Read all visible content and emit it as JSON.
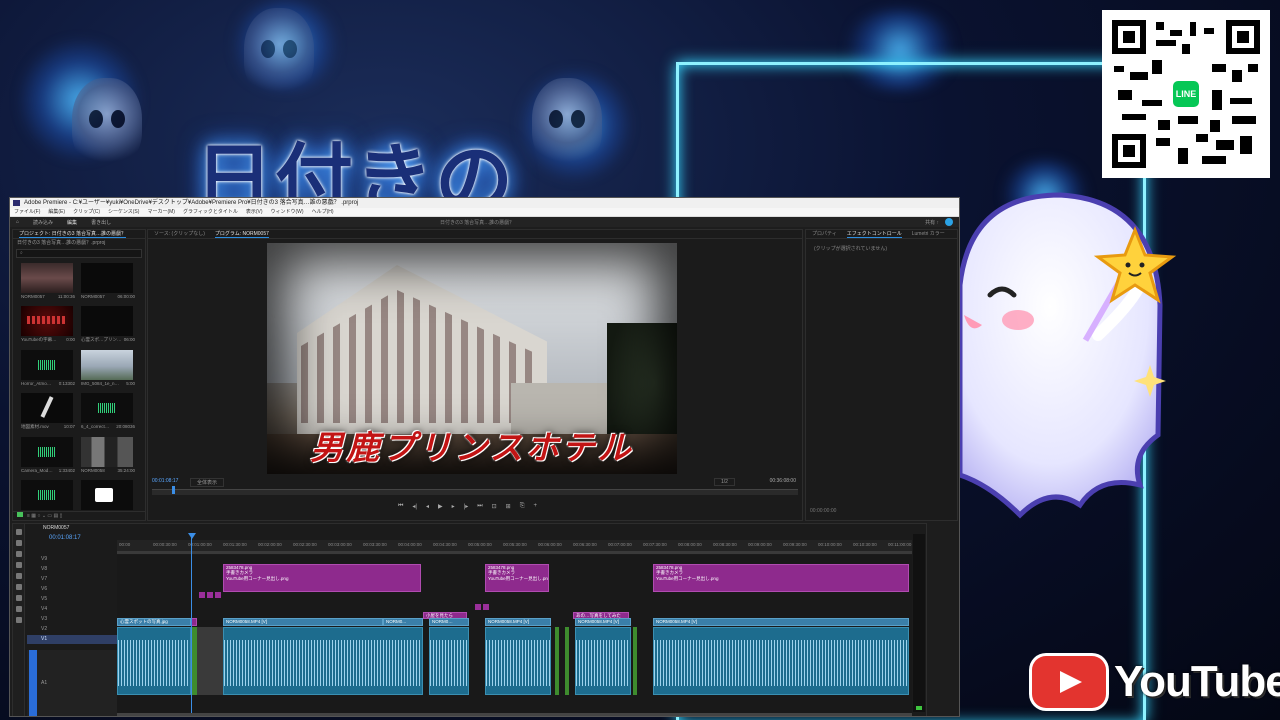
{
  "overlay": {
    "title_text": "日付きの",
    "line_label": "LINE",
    "youtube_label": "YouTube"
  },
  "premiere": {
    "titlebar": "Adobe Premiere - C:¥ユーザー¥yuki¥OneDrive¥デスクトップ¥Adobe¥Premiere Pro¥日付きの3 落合写真…誰の悪戯？ .prproj",
    "menu": [
      "ファイル(F)",
      "編集(E)",
      "クリップ(C)",
      "シーケンス(S)",
      "マーカー(M)",
      "グラフィックとタイトル",
      "表示(V)",
      "ウィンドウ(W)",
      "ヘルプ(H)"
    ],
    "workspaces": [
      "ホーム",
      "読み込み",
      "編集",
      "書き出し"
    ],
    "doc_title": "日付きの3 落合写真…誰の悪戯？",
    "share_label": "共有 ↑",
    "project": {
      "tab": "プロジェクト: 日付きの3 落合写真…誰の悪戯？",
      "path": "日付きの3 落合写真…誰の悪戯？.prproj",
      "items": [
        {
          "name": "NORM0057",
          "dur": "11:00:36"
        },
        {
          "name": "NORM0057",
          "dur": "06:00:00"
        },
        {
          "name": "YouTubeの字幕…",
          "dur": "0:00"
        },
        {
          "name": "心霊スポ…プリン…",
          "dur": "06:00"
        },
        {
          "name": "Horror_Atmo…",
          "dur": "0:13302"
        },
        {
          "name": "IMG_5084_1e_n…",
          "dur": "5:00"
        },
        {
          "name": "地図素材.mov",
          "dur": "10:07"
        },
        {
          "name": "6_4_correct…",
          "dur": "20:08036"
        },
        {
          "name": "Camera_Mod…",
          "dur": "1:33402"
        },
        {
          "name": "NORM0058",
          "dur": "35:24:00"
        },
        {
          "name": "",
          "dur": ""
        },
        {
          "name": "",
          "dur": ""
        }
      ]
    },
    "program": {
      "tabs": [
        "ソース: (クリップなし)",
        "プログラム: NORM0057"
      ],
      "caption": "男鹿プリンスホテル",
      "timecode": "00:01:08:17",
      "fit": "全体表示",
      "quality": "1/2",
      "duration": "00:36:08:00",
      "transport": [
        "⏮",
        "◂|",
        "◂",
        "▶",
        "▸",
        "|▸",
        "⏭",
        "⊡",
        "⊞",
        "⎘",
        "+"
      ]
    },
    "effects": {
      "tabs": [
        "プロパティ",
        "エフェクトコントロール",
        "Lumetri カラー"
      ],
      "message": "(クリップが選択されていません)",
      "time": "00:00:00:00"
    },
    "timeline": {
      "sequence": "NORM0057",
      "timecode": "00:01:08:17",
      "ruler": [
        "00:00",
        "00:00:30:00",
        "00:01:00:00",
        "00:01:30:00",
        "00:02:00:00",
        "00:02:30:00",
        "00:03:00:00",
        "00:03:30:00",
        "00:04:00:00",
        "00:04:30:00",
        "00:05:00:00",
        "00:05:30:00",
        "00:06:00:00",
        "00:06:30:00",
        "00:07:00:00",
        "00:07:30:00",
        "00:08:00:00",
        "00:08:30:00",
        "00:09:00:00",
        "00:09:30:00",
        "00:10:00:00",
        "00:10:30:00",
        "00:11:00:00"
      ],
      "tracks": [
        "V9",
        "V8",
        "V7",
        "V6",
        "V5",
        "V4",
        "V3",
        "V2",
        "V1"
      ],
      "audio_track": "A1",
      "clip_labels": {
        "p1a": "2583478.png",
        "p1b": "手書きカメラ",
        "p1c": "YouTube用コーナー見出し.png",
        "p2a": "2583478.png",
        "p2b": "手書きカメラ",
        "p2c": "YouTube用コーナー見出し.png",
        "p3a": "2583478.png",
        "p3b": "手書きカメラ",
        "p3c": "YouTube用コーナー見出し.png",
        "b1": "心霊スポットの写真.jpg",
        "b2": "NORM0058.MP4 [V]",
        "b3": "NORM0...",
        "b4": "NORM0…",
        "b5": "NORM0058.MP4 [V]",
        "b6": "NORM0058.MP4 [V]",
        "b7": "NORM0058.MP4 [V]",
        "tp1": "小屋を見たら",
        "tp2": "あの…写真をしてみた"
      }
    }
  }
}
